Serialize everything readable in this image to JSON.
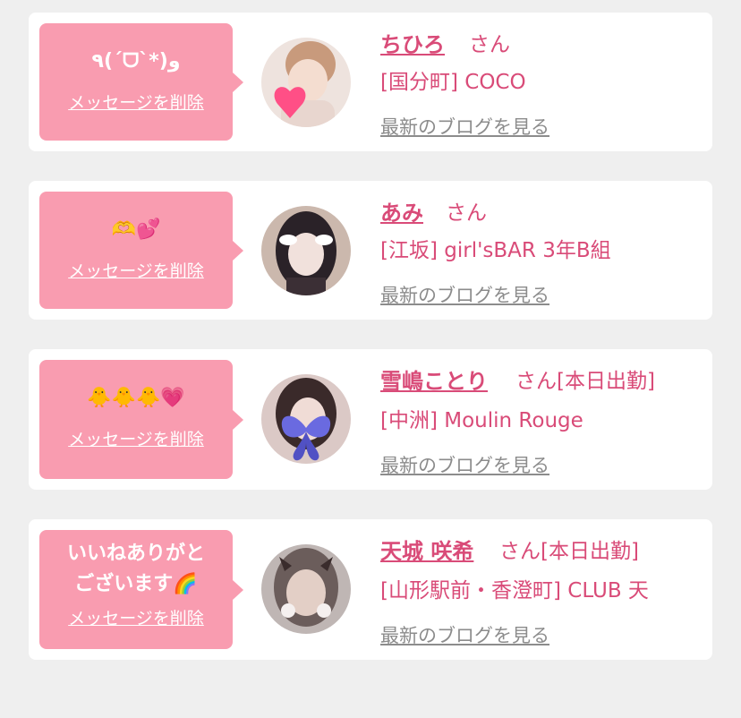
{
  "cards": [
    {
      "message": "٩(ˊᗜˋ*)و",
      "delete_label": "メッセージを削除",
      "name": "ちひろ",
      "suffix": "さん",
      "shop": "[国分町] COCO",
      "blog_link": "最新のブログを見る",
      "avatar_colors": [
        "#f1ddd2",
        "#c89a7c"
      ]
    },
    {
      "message": "🫶💕",
      "delete_label": "メッセージを削除",
      "name": "あみ",
      "suffix": "さん",
      "shop": "[江坂] girl'sBAR 3年B組",
      "blog_link": "最新のブログを見る",
      "avatar_colors": [
        "#cbb8ad",
        "#2a2228"
      ]
    },
    {
      "message": "🐥🐥🐥💗",
      "delete_label": "メッセージを削除",
      "name": "雪嶋ことり",
      "suffix": "さん[本日出勤]",
      "shop": "[中洲] Moulin Rouge",
      "blog_link": "最新のブログを見る",
      "avatar_colors": [
        "#dbc9c6",
        "#5a5ad0"
      ]
    },
    {
      "message": "いいねありがとございます🌈",
      "delete_label": "メッセージを削除",
      "name": "天城 咲希",
      "suffix": "さん[本日出勤]",
      "shop": "[山形駅前・香澄町] CLUB 天",
      "blog_link": "最新のブログを見る",
      "avatar_colors": [
        "#bfb6b4",
        "#6b5d5b"
      ]
    }
  ],
  "colors": {
    "bubble": "#f99cb0",
    "name": "#d94b78",
    "link_gray": "#8c8c8c",
    "background": "#efefef"
  }
}
